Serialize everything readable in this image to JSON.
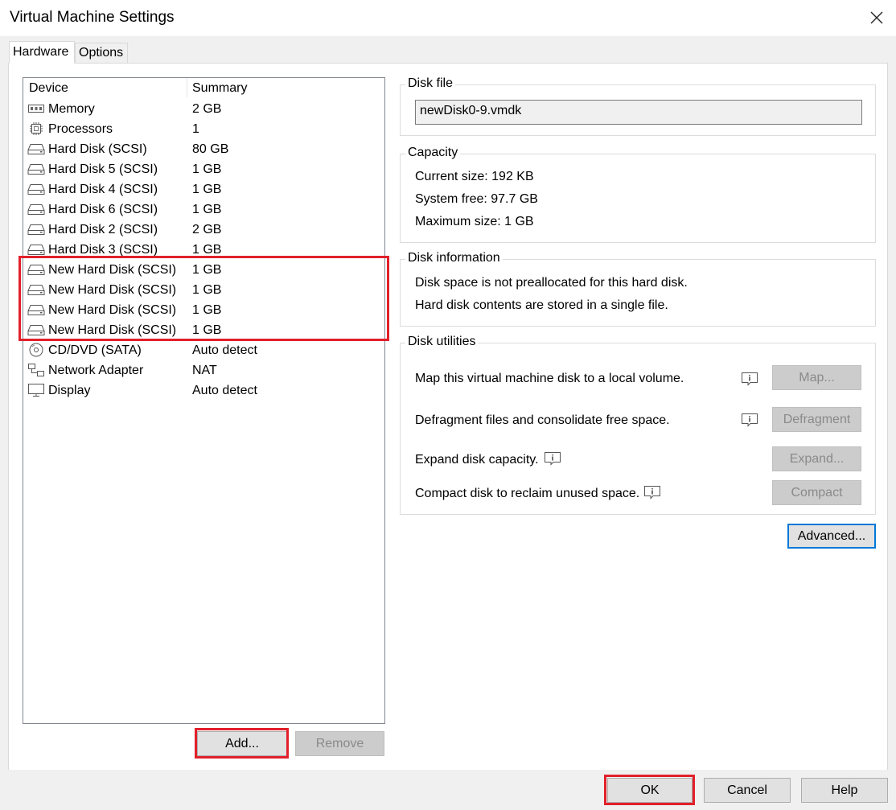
{
  "window": {
    "title": "Virtual Machine Settings"
  },
  "tabs": [
    {
      "label": "Hardware"
    },
    {
      "label": "Options"
    }
  ],
  "device_list": {
    "headers": {
      "device": "Device",
      "summary": "Summary"
    },
    "rows": [
      {
        "icon": "memory-icon",
        "name": "Memory",
        "summary": "2 GB"
      },
      {
        "icon": "processor-icon",
        "name": "Processors",
        "summary": "1"
      },
      {
        "icon": "hard-disk-icon",
        "name": "Hard Disk (SCSI)",
        "summary": "80 GB"
      },
      {
        "icon": "hard-disk-icon",
        "name": "Hard Disk 5 (SCSI)",
        "summary": "1 GB"
      },
      {
        "icon": "hard-disk-icon",
        "name": "Hard Disk 4 (SCSI)",
        "summary": "1 GB"
      },
      {
        "icon": "hard-disk-icon",
        "name": "Hard Disk 6 (SCSI)",
        "summary": "1 GB"
      },
      {
        "icon": "hard-disk-icon",
        "name": "Hard Disk 2 (SCSI)",
        "summary": "2 GB"
      },
      {
        "icon": "hard-disk-icon",
        "name": "Hard Disk 3 (SCSI)",
        "summary": "1 GB"
      },
      {
        "icon": "hard-disk-icon",
        "name": "New Hard Disk (SCSI)",
        "summary": "1 GB"
      },
      {
        "icon": "hard-disk-icon",
        "name": "New Hard Disk (SCSI)",
        "summary": "1 GB"
      },
      {
        "icon": "hard-disk-icon",
        "name": "New Hard Disk (SCSI)",
        "summary": "1 GB"
      },
      {
        "icon": "hard-disk-icon",
        "name": "New Hard Disk (SCSI)",
        "summary": "1 GB"
      },
      {
        "icon": "cd-dvd-icon",
        "name": "CD/DVD (SATA)",
        "summary": "Auto detect"
      },
      {
        "icon": "network-adapter-icon",
        "name": "Network Adapter",
        "summary": "NAT"
      },
      {
        "icon": "display-icon",
        "name": "Display",
        "summary": "Auto detect"
      }
    ],
    "add_label": "Add...",
    "remove_label": "Remove"
  },
  "disk_file": {
    "title": "Disk file",
    "value": "newDisk0-9.vmdk"
  },
  "capacity": {
    "title": "Capacity",
    "current_size": "Current size:  192 KB",
    "system_free": "System free:  97.7 GB",
    "maximum_size": "Maximum size:  1 GB"
  },
  "disk_information": {
    "title": "Disk information",
    "line1": "Disk space is not preallocated for this hard disk.",
    "line2": "Hard disk contents are stored in a single file."
  },
  "disk_utilities": {
    "title": "Disk utilities",
    "map_text": "Map this virtual machine disk to a local volume.",
    "map_label": "Map...",
    "defrag_text": "Defragment files and consolidate free space.",
    "defrag_label": "Defragment",
    "expand_text": "Expand disk capacity.",
    "expand_label": "Expand...",
    "compact_text": "Compact disk to reclaim unused space.",
    "compact_label": "Compact"
  },
  "advanced_label": "Advanced...",
  "footer": {
    "ok_label": "OK",
    "cancel_label": "Cancel",
    "help_label": "Help"
  },
  "colors": {
    "highlight": "#e1202a",
    "accent": "#0078d7",
    "panel": "#f0f0f0"
  }
}
